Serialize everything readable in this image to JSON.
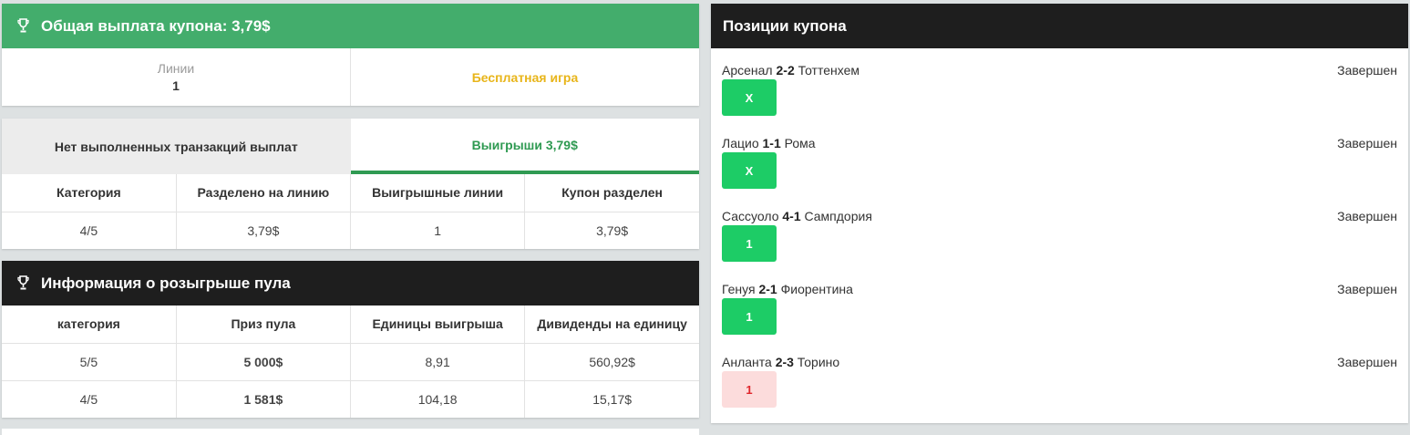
{
  "payout_card": {
    "title": "Общая выплата купона: 3,79$",
    "lines_label": "Линии",
    "lines_value": "1",
    "free_game": "Бесплатная игра"
  },
  "winnings_card": {
    "tab_no_transactions": "Нет выполненных транзакций выплат",
    "tab_winnings": "Выигрыши 3,79$",
    "columns": [
      "Категория",
      "Разделено на линию",
      "Выигрышные линии",
      "Купон разделен"
    ],
    "rows": [
      [
        "4/5",
        "3,79$",
        "1",
        "3,79$"
      ]
    ]
  },
  "pool_card": {
    "title": "Информация о розыгрыше пула",
    "columns": [
      "категория",
      "Приз пула",
      "Единицы выигрыша",
      "Дивиденды на единицу"
    ],
    "rows": [
      [
        "5/5",
        "5 000$",
        "8,91",
        "560,92$"
      ],
      [
        "4/5",
        "1 581$",
        "104,18",
        "15,17$"
      ]
    ]
  },
  "positions": {
    "title": "Позиции купона",
    "items": [
      {
        "home": "Арсенал",
        "score": "2-2",
        "away": "Тоттенхем",
        "status": "Завершен",
        "pick": "X",
        "correct": true
      },
      {
        "home": "Лацио",
        "score": "1-1",
        "away": "Рома",
        "status": "Завершен",
        "pick": "X",
        "correct": true
      },
      {
        "home": "Сассуоло",
        "score": "4-1",
        "away": "Сампдория",
        "status": "Завершен",
        "pick": "1",
        "correct": true
      },
      {
        "home": "Генуя",
        "score": "2-1",
        "away": "Фиорентина",
        "status": "Завершен",
        "pick": "1",
        "correct": true
      },
      {
        "home": "Анланта",
        "score": "2-3",
        "away": "Торино",
        "status": "Завершен",
        "pick": "1",
        "correct": false
      }
    ]
  },
  "colors": {
    "green_header": "#43ad6c",
    "dark_header": "#1e1e1e",
    "active_tab": "#2f9a52",
    "free_game": "#e8b51a",
    "badge_win": "#1dcc66",
    "badge_lose_bg": "#fcdcdc",
    "badge_lose_text": "#e0262b"
  },
  "icons": {
    "header_icon": "trophy-icon"
  }
}
